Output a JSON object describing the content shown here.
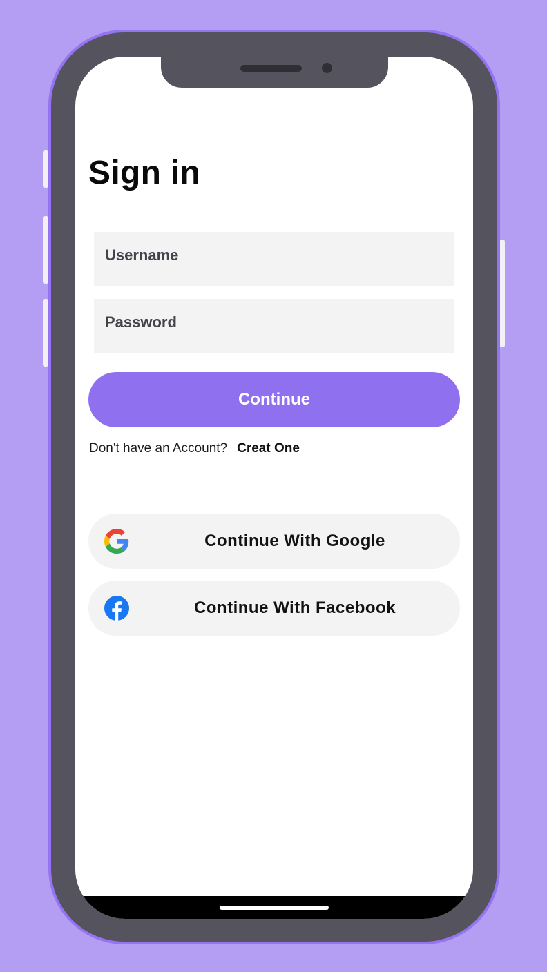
{
  "colors": {
    "background": "#b39ef3",
    "frame": "#55535d",
    "frame_border": "#9474f0",
    "accent": "#8f70ef",
    "field_bg": "#f3f3f3"
  },
  "screen": {
    "title": "Sign in"
  },
  "form": {
    "username_placeholder": "Username",
    "password_placeholder": "Password",
    "continue_label": "Continue"
  },
  "signup": {
    "prompt": "Don't have an Account?",
    "link_label": "Creat One"
  },
  "social": [
    {
      "label": "Continue With Google",
      "icon": "google-icon"
    },
    {
      "label": "Continue With Facebook",
      "icon": "facebook-icon"
    }
  ]
}
